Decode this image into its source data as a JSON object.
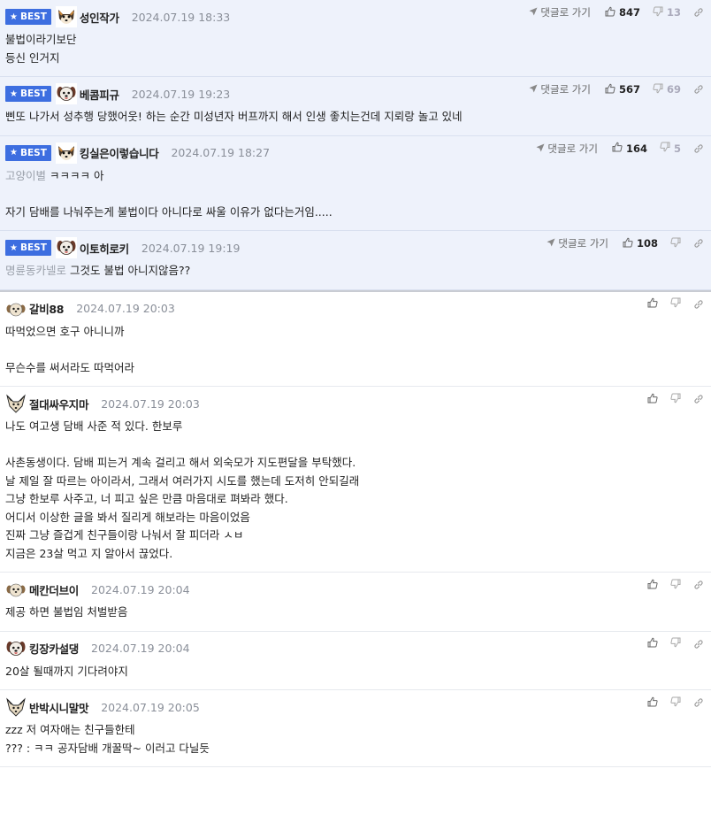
{
  "reply_label": "댓글로 가기",
  "best_label": "BEST",
  "colors": {
    "best_bg": "#eef2fb",
    "badge": "#3d6ee0"
  },
  "best_comments": [
    {
      "nick": "성인작가",
      "date": "2024.07.19 18:33",
      "avatar": "shiba-avatar-icon",
      "likes": "847",
      "dislikes": "13",
      "mention": "",
      "lines": [
        "불법이라기보단",
        "등신 인거지"
      ]
    },
    {
      "nick": "베콤피규",
      "date": "2024.07.19 19:23",
      "avatar": "dog-avatar-icon",
      "likes": "567",
      "dislikes": "69",
      "mention": "",
      "lines": [
        "삔또 나가서 성추행 당했어웃! 하는 순간 미성년자 버프까지 해서 인생 좋치는건데 지뢰랑 놀고 있네"
      ]
    },
    {
      "nick": "킹실은이렇습니다",
      "date": "2024.07.19 18:27",
      "avatar": "shiba-avatar-icon",
      "likes": "164",
      "dislikes": "5",
      "mention": "고양이별",
      "lines": [
        "ㅋㅋㅋㅋ 아",
        "",
        "자기 담배를 나눠주는게 불법이다 아니다로 싸울 이유가 없다는거임....."
      ]
    },
    {
      "nick": "이토히로키",
      "date": "2024.07.19 19:19",
      "avatar": "dog-avatar-icon",
      "likes": "108",
      "dislikes": "",
      "mention": "명륜동카넬로",
      "lines": [
        "그것도 불법 아니지않음??"
      ]
    }
  ],
  "comments": [
    {
      "nick": "갈비88",
      "date": "2024.07.19 20:03",
      "avatar": "puppy-avatar-icon",
      "lines": [
        "따먹었으면 호구 아니니까",
        "",
        "무슨수를 써서라도 따먹어라"
      ]
    },
    {
      "nick": "절대싸우지마",
      "date": "2024.07.19 20:03",
      "avatar": "fox-avatar-icon",
      "lines": [
        "나도 여고생 담배 사준 적 있다. 한보루",
        "",
        "사촌동생이다. 담배 피는거 계속 걸리고 해서 외숙모가 지도편달을 부탁했다.",
        "날 제일 잘 따르는 아이라서, 그래서 여러가지 시도를 했는데 도저히 안되길래",
        "그냥 한보루 사주고, 너 피고 싶은 만큼 마음대로 펴봐라 했다.",
        "어디서 이상한 글을 봐서 질리게 해보라는 마음이었음",
        "진짜 그냥 즐겁게 친구들이랑 나눠서 잘 피더라 ㅅㅂ",
        "지금은 23살 먹고 지 알아서 끊었다."
      ]
    },
    {
      "nick": "메칸더브이",
      "date": "2024.07.19 20:04",
      "avatar": "puppy-avatar-icon",
      "lines": [
        "제공 하면 불법임 처벌받음"
      ]
    },
    {
      "nick": "킹장카설댕",
      "date": "2024.07.19 20:04",
      "avatar": "dog-avatar-icon",
      "lines": [
        "20살 될때까지 기다려야지"
      ]
    },
    {
      "nick": "반박시니말맛",
      "date": "2024.07.19 20:05",
      "avatar": "fox-avatar-icon",
      "lines": [
        "zzz 저 여자애는 친구들한테",
        "??? : ㅋㅋ 공자담배 개꿀딱~ 이러고 다닐듯"
      ]
    }
  ]
}
